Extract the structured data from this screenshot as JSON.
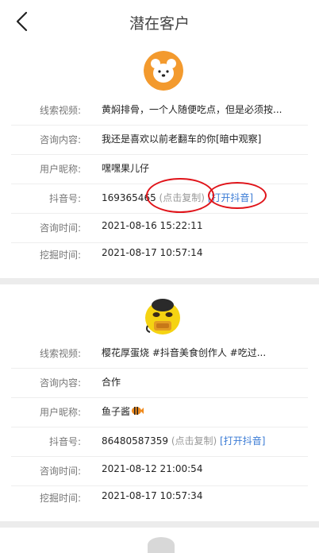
{
  "header": {
    "title": "潜在客户"
  },
  "leads": [
    {
      "rows": [
        {
          "label": "线索视频:",
          "value": "黄焖排骨，一个人随便吃点，但是必须按..."
        },
        {
          "label": "咨询内容:",
          "value": "我还是喜欢以前老翻车的你[暗中观察]"
        },
        {
          "label": "用户昵称:",
          "value": "嘿嘿果儿仔"
        },
        {
          "label": "抖音号:",
          "value": "169365465",
          "copy": "(点击复制)",
          "open": "[打开抖音]"
        },
        {
          "label": "咨询时间:",
          "value": "2021-08-16 15:22:11"
        },
        {
          "label": "挖掘时间:",
          "value": "2021-08-17 10:57:14"
        }
      ]
    },
    {
      "rows": [
        {
          "label": "线索视频:",
          "value": "樱花厚蛋烧 #抖音美食创作人 #吃过..."
        },
        {
          "label": "咨询内容:",
          "value": "合作"
        },
        {
          "label": "用户昵称:",
          "value": "鱼子酱"
        },
        {
          "label": "抖音号:",
          "value": "86480587359",
          "copy": "(点击复制)",
          "open": "[打开抖音]"
        },
        {
          "label": "咨询时间:",
          "value": "2021-08-12 21:00:54"
        },
        {
          "label": "挖掘时间:",
          "value": "2021-08-17 10:57:34"
        }
      ]
    }
  ],
  "colors": {
    "accent": "#3a7bd5",
    "annotation": "#e0141a",
    "avatar_bg": "#f39a2e",
    "separator": "#ececec"
  }
}
